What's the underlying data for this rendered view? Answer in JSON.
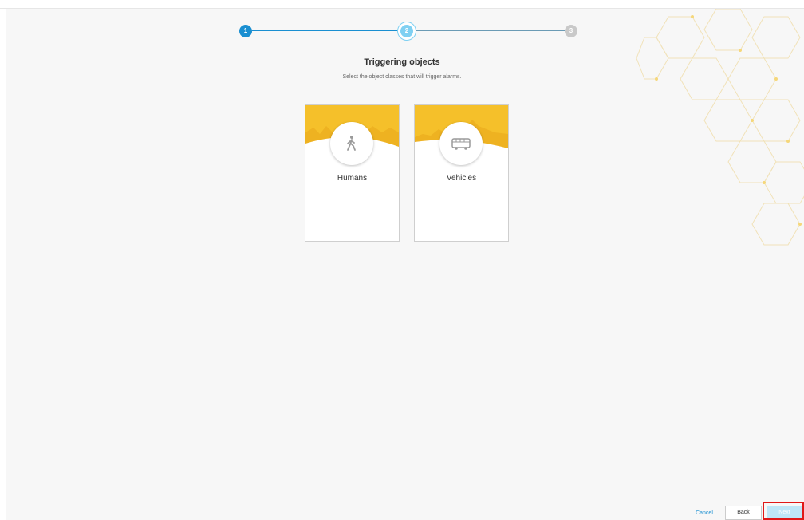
{
  "stepper": {
    "steps": [
      "1",
      "2",
      "3"
    ],
    "current": 2
  },
  "header": {
    "title": "Triggering objects",
    "subtitle": "Select the object classes that will trigger alarms."
  },
  "cards": [
    {
      "label": "Humans",
      "icon": "walking-person-icon"
    },
    {
      "label": "Vehicles",
      "icon": "bus-icon"
    }
  ],
  "footer": {
    "cancel_label": "Cancel",
    "back_label": "Back",
    "next_label": "Next"
  },
  "colors": {
    "accent": "#1a8fd1",
    "active_step": "#7fd0f2",
    "inactive_step": "#c9c9c9",
    "banner": "#f5c02a",
    "highlight": "#e01818"
  }
}
